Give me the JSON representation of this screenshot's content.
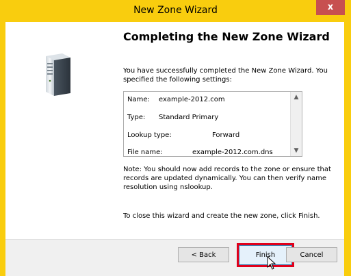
{
  "window": {
    "title": "New Zone Wizard",
    "close_glyph": "x"
  },
  "wizard": {
    "heading": "Completing the New Zone Wizard",
    "intro": "You have successfully completed the New Zone Wizard. You specified the following settings:",
    "settings": [
      {
        "label": "Name:",
        "value": "example-2012.com"
      },
      {
        "label": "Type:",
        "value": "Standard Primary"
      },
      {
        "label": "Lookup type:",
        "value": "Forward"
      },
      {
        "label": "File name:",
        "value": "example-2012.com.dns"
      }
    ],
    "note": "Note: You should now add records to the zone or ensure that records are updated dynamically. You can then verify name resolution using nslookup.",
    "closing": "To close this wizard and create the new zone, click Finish."
  },
  "buttons": {
    "back": "< Back",
    "finish": "Finish",
    "cancel": "Cancel"
  },
  "colors": {
    "frame": "#f9cd0e",
    "close_button": "#c75050",
    "highlight": "#e0001b"
  },
  "icons": {
    "server": "server-icon",
    "scroll_up": "scroll-up-arrow-icon",
    "scroll_down": "scroll-down-arrow-icon",
    "cursor": "mouse-pointer-icon"
  }
}
